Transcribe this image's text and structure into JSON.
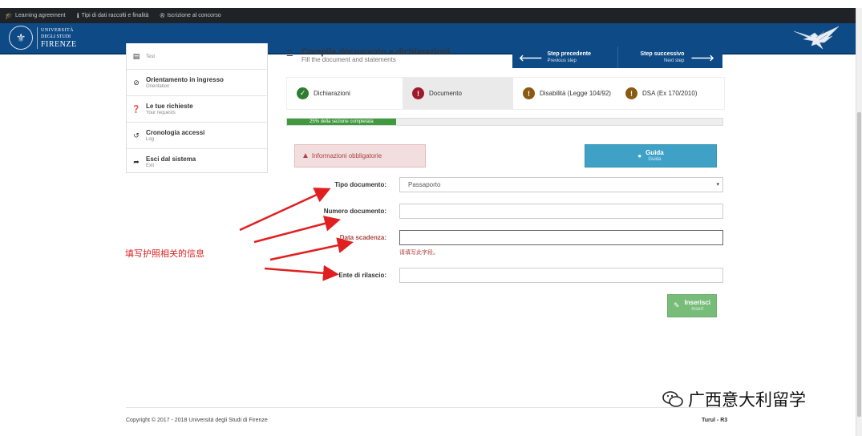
{
  "topbar": {
    "items": [
      {
        "icon": "graduation-cap-icon",
        "glyph": "🎓",
        "label": "Learning agreement"
      },
      {
        "icon": "info-icon",
        "glyph": "ℹ",
        "label": "Tipi di dati raccolti e finalità"
      },
      {
        "icon": "registered-icon",
        "glyph": "®",
        "label": "Iscrizione al concorso"
      }
    ]
  },
  "header": {
    "logo_line1": "UNIVERSITÀ",
    "logo_line2": "DEGLI STUDI",
    "logo_line3": "FIRENZE",
    "background": "#0e4a86"
  },
  "sidebar": {
    "items": [
      {
        "icon": "list-icon",
        "glyph": "▤",
        "label": "",
        "sub": "Test"
      },
      {
        "icon": "compass-icon",
        "glyph": "⊘",
        "label": "Orientamento in ingresso",
        "sub": "Orientation"
      },
      {
        "icon": "question-icon",
        "glyph": "❓",
        "label": "Le tue richieste",
        "sub": "Your requests"
      },
      {
        "icon": "history-icon",
        "glyph": "↺",
        "label": "Cronologia accessi",
        "sub": "Log"
      },
      {
        "icon": "logout-icon",
        "glyph": "➦",
        "label": "Esci dal sistema",
        "sub": "Exit"
      }
    ]
  },
  "page": {
    "title": "Compila documento e dichiarazioni",
    "subtitle": "Fill the document and statements"
  },
  "stepnav": {
    "prev_label": "Step precedente",
    "prev_sub": "Previous step",
    "next_label": "Step successivo",
    "next_sub": "Next step"
  },
  "tabs": [
    {
      "label": "Dichiarazioni",
      "status": "done",
      "glyph": "✓",
      "color": "#2e7d32"
    },
    {
      "label": "Documento",
      "status": "error",
      "glyph": "!",
      "color": "#9e1c2a"
    },
    {
      "label": "Disabilità (Legge 104/92)",
      "status": "warning",
      "glyph": "!",
      "color": "#8a5a12"
    },
    {
      "label": "DSA (Ex 170/2010)",
      "status": "warning",
      "glyph": "!",
      "color": "#8a5a12"
    }
  ],
  "progress": {
    "label": "25% della sezione completata",
    "value": 25
  },
  "alert": {
    "label": "Informazioni obbligatorie"
  },
  "guida": {
    "label": "Guida",
    "sub": "Guida"
  },
  "form": {
    "tipo_label": "Tipo documento:",
    "tipo_value": "Passaporto",
    "numero_label": "Numero documento:",
    "numero_value": "",
    "scadenza_label": "Data scadenza:",
    "scadenza_value": "",
    "scadenza_error": "请填写此字段。",
    "ente_label": "Ente di rilascio:",
    "ente_value": ""
  },
  "inserisci": {
    "label": "Inserisci",
    "sub": "Insert"
  },
  "annotation": "填写护照相关的信息",
  "footer": {
    "copyright": "Copyright © 2017 - 2018 Università degli Studi di Firenze",
    "version": "Turul - R3"
  },
  "watermark": "广西意大利留学"
}
